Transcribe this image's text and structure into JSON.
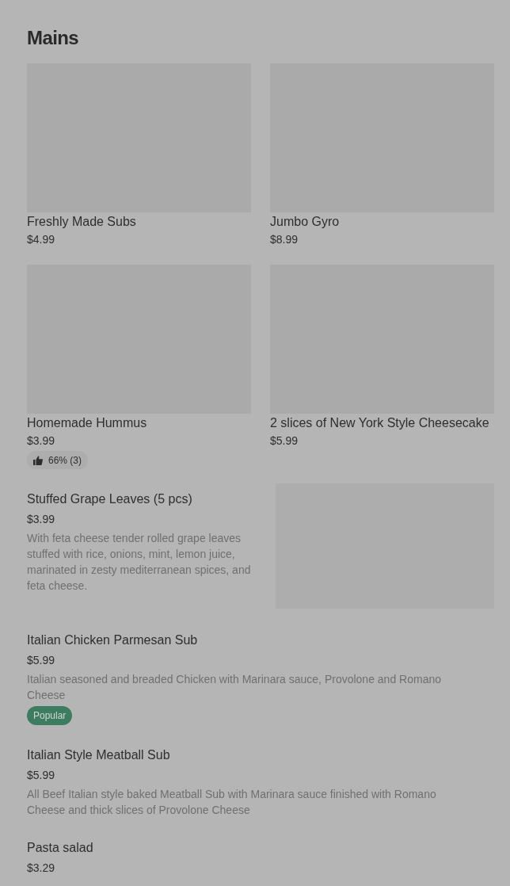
{
  "section_title": "Mains",
  "grid_items": [
    {
      "name": "Freshly Made Subs",
      "price": "$4.99"
    },
    {
      "name": "Jumbo Gyro",
      "price": "$8.99"
    },
    {
      "name": "Homemade Hummus",
      "price": "$3.99",
      "rating": "66% (3)"
    },
    {
      "name": "2 slices of New York Style Cheesecake",
      "price": "$5.99"
    }
  ],
  "list_items": [
    {
      "name": "Stuffed Grape Leaves (5 pcs)",
      "price": "$3.99",
      "description": "With feta cheese tender rolled grape leaves stuffed with rice, onions, mint, lemon juice, marinated in zesty mediterranean spices, and feta cheese.",
      "has_image": true
    },
    {
      "name": "Italian Chicken Parmesan Sub",
      "price": "$5.99",
      "description": "Italian seasoned and breaded Chicken with Marinara sauce, Provolone and Romano Cheese",
      "badge": "Popular",
      "has_image": false
    },
    {
      "name": "Italian Style Meatball Sub",
      "price": "$5.99",
      "description": "All Beef Italian style baked Meatball Sub with Marinara sauce finished with Romano Cheese and thick slices of Provolone Cheese",
      "has_image": false
    },
    {
      "name": "Pasta salad",
      "price": "$3.29",
      "has_image": false
    }
  ]
}
